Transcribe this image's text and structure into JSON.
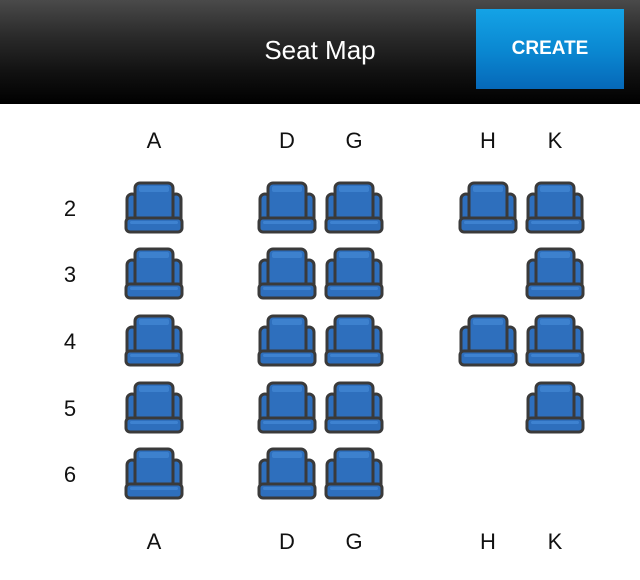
{
  "header": {
    "title": "Seat Map",
    "create_label": "CREATE"
  },
  "colors": {
    "seat_fill": "#2e6fbd",
    "seat_outline": "#3a3a3a",
    "seat_light": "#4a8fdc",
    "header_bg": "#000000",
    "button_bg": "#0a86d0"
  },
  "columns": [
    "A",
    "D",
    "G",
    "H",
    "K"
  ],
  "rows": [
    "2",
    "3",
    "4",
    "5",
    "6"
  ],
  "seats": [
    {
      "row": "2",
      "col": "A"
    },
    {
      "row": "2",
      "col": "D"
    },
    {
      "row": "2",
      "col": "G"
    },
    {
      "row": "2",
      "col": "H"
    },
    {
      "row": "2",
      "col": "K"
    },
    {
      "row": "3",
      "col": "A"
    },
    {
      "row": "3",
      "col": "D"
    },
    {
      "row": "3",
      "col": "G"
    },
    {
      "row": "3",
      "col": "K"
    },
    {
      "row": "4",
      "col": "A"
    },
    {
      "row": "4",
      "col": "D"
    },
    {
      "row": "4",
      "col": "G"
    },
    {
      "row": "4",
      "col": "H"
    },
    {
      "row": "4",
      "col": "K"
    },
    {
      "row": "5",
      "col": "A"
    },
    {
      "row": "5",
      "col": "D"
    },
    {
      "row": "5",
      "col": "G"
    },
    {
      "row": "5",
      "col": "K"
    },
    {
      "row": "6",
      "col": "A"
    },
    {
      "row": "6",
      "col": "D"
    },
    {
      "row": "6",
      "col": "G"
    }
  ]
}
